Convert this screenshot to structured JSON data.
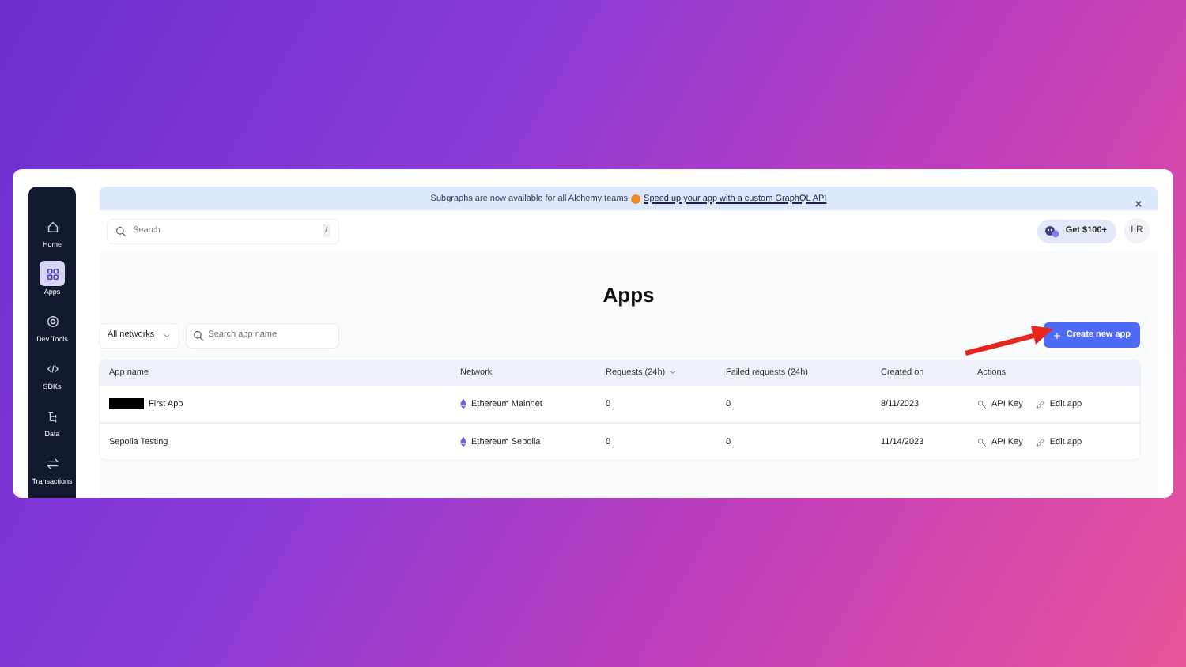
{
  "sidebar": {
    "items": [
      {
        "label": "Home",
        "selected": false
      },
      {
        "label": "Apps",
        "selected": true
      },
      {
        "label": "Dev Tools",
        "selected": false
      },
      {
        "label": "SDKs",
        "selected": false
      },
      {
        "label": "Data",
        "selected": false
      },
      {
        "label": "Transactions",
        "selected": false
      }
    ]
  },
  "banner": {
    "text": "Subgraphs are now available for all Alchemy teams",
    "link": "Speed up your app with a custom GraphQL API"
  },
  "search": {
    "placeholder": "Search",
    "shortcut": "/"
  },
  "reward": {
    "label": "Get $100+"
  },
  "avatar": {
    "initials": "LR"
  },
  "title": "Apps",
  "filter": {
    "value": "All networks"
  },
  "app_search": {
    "placeholder": "Search app name"
  },
  "create_button": {
    "label": "Create new app"
  },
  "table": {
    "columns": [
      {
        "label": "App name",
        "sortable": false
      },
      {
        "label": "Network",
        "sortable": false
      },
      {
        "label": "Requests (24h)",
        "sortable": true
      },
      {
        "label": "Failed requests (24h)",
        "sortable": false
      },
      {
        "label": "Created on",
        "sortable": false
      },
      {
        "label": "Actions",
        "sortable": false
      }
    ],
    "rows": [
      {
        "name": "First App",
        "redacted": true,
        "network": "Ethereum Mainnet",
        "requests": "0",
        "failed": "0",
        "created": "8/11/2023",
        "actions": [
          "API Key",
          "Edit app"
        ]
      },
      {
        "name": "Sepolia Testing",
        "redacted": false,
        "network": "Ethereum Sepolia",
        "requests": "0",
        "failed": "0",
        "created": "11/14/2023",
        "actions": [
          "API Key",
          "Edit app"
        ]
      }
    ]
  },
  "annotation": {
    "arrow": true
  }
}
